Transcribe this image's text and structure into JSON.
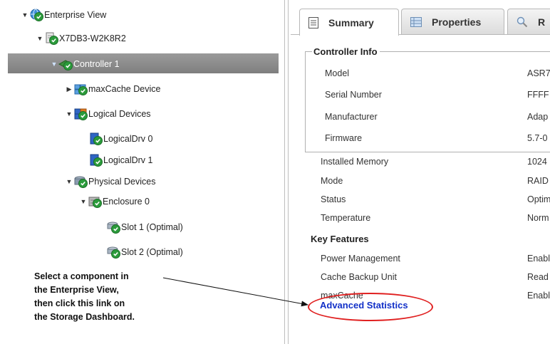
{
  "tree": {
    "root": "Enterprise View",
    "server": "X7DB3-W2K8R2",
    "controller": "Controller 1",
    "maxcache_device": "maxCache Device",
    "logical_devices": "Logical Devices",
    "logical_drive_0": "LogicalDrv 0",
    "logical_drive_1": "LogicalDrv 1",
    "physical_devices": "Physical Devices",
    "enclosure": "Enclosure 0",
    "slot_1": "Slot 1 (Optimal)",
    "slot_2": "Slot 2 (Optimal)"
  },
  "tabs": [
    {
      "label": "Summary",
      "icon": "document-lines-icon"
    },
    {
      "label": "Properties",
      "icon": "properties-grid-icon"
    },
    {
      "label": "R",
      "icon": "magnifier-icon"
    }
  ],
  "controller_info": {
    "title": "Controller Info",
    "rows": [
      {
        "label": "Model",
        "value": "ASR7"
      },
      {
        "label": "Serial Number",
        "value": "FFFF"
      },
      {
        "label": "Manufacturer",
        "value": "Adap"
      },
      {
        "label": "Firmware",
        "value": "5.7-0"
      }
    ]
  },
  "details": [
    {
      "label": "Installed Memory",
      "value": "1024"
    },
    {
      "label": "Mode",
      "value": "RAID"
    },
    {
      "label": "Status",
      "value": "Optim"
    },
    {
      "label": "Temperature",
      "value": "Norm"
    }
  ],
  "key_features": {
    "title": "Key Features",
    "rows": [
      {
        "label": "Power Management",
        "value": "Enabl"
      },
      {
        "label": "Cache Backup Unit",
        "value": "Read"
      },
      {
        "label": "maxCache",
        "value": "Enabl"
      }
    ]
  },
  "advanced_statistics_link": "Advanced Statistics",
  "callout": {
    "line1": "Select a component in",
    "line2": "the Enterprise View,",
    "line3": "then click this link on",
    "line4": "the Storage Dashboard."
  },
  "colors": {
    "selected_row": "#8c8c8c",
    "status_green": "#2b9b3b",
    "link_blue": "#1230c8",
    "highlight_red": "#e02020"
  }
}
